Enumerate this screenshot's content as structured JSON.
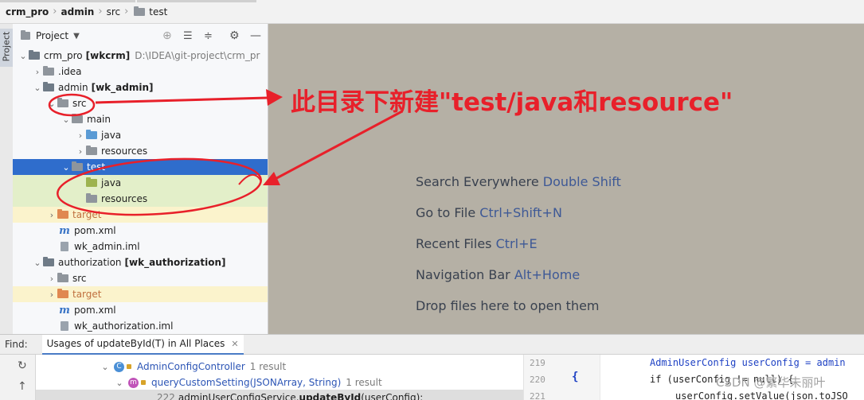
{
  "breadcrumb": {
    "items": [
      "crm_pro",
      "admin",
      "src",
      "test"
    ]
  },
  "side_tab": {
    "label": "Project"
  },
  "project_panel": {
    "title": "Project",
    "tree": [
      {
        "label": "crm_pro",
        "module": "[wkcrm]",
        "path": "D:\\IDEA\\git-project\\crm_pr",
        "kind": "module",
        "state": "open"
      },
      {
        "label": ".idea",
        "kind": "folder",
        "state": "closed"
      },
      {
        "label": "admin",
        "module": "[wk_admin]",
        "kind": "module",
        "state": "open"
      },
      {
        "label": "src",
        "kind": "folder",
        "state": "open"
      },
      {
        "label": "main",
        "kind": "folder",
        "state": "open"
      },
      {
        "label": "java",
        "kind": "source",
        "state": "closed"
      },
      {
        "label": "resources",
        "kind": "resources",
        "state": "closed"
      },
      {
        "label": "test",
        "kind": "folder",
        "state": "open",
        "selected": true
      },
      {
        "label": "java",
        "kind": "test-source"
      },
      {
        "label": "resources",
        "kind": "test-resources"
      },
      {
        "label": "target",
        "kind": "excluded",
        "state": "closed"
      },
      {
        "label": "pom.xml",
        "kind": "maven"
      },
      {
        "label": "wk_admin.iml",
        "kind": "iml"
      },
      {
        "label": "authorization",
        "module": "[wk_authorization]",
        "kind": "module",
        "state": "open"
      },
      {
        "label": "src",
        "kind": "folder",
        "state": "closed"
      },
      {
        "label": "target",
        "kind": "excluded",
        "state": "closed"
      },
      {
        "label": "pom.xml",
        "kind": "maven"
      },
      {
        "label": "wk_authorization.iml",
        "kind": "iml"
      }
    ]
  },
  "editor": {
    "hints": [
      {
        "text": "Search Everywhere",
        "key": "Double Shift"
      },
      {
        "text": "Go to File",
        "key": "Ctrl+Shift+N"
      },
      {
        "text": "Recent Files",
        "key": "Ctrl+E"
      },
      {
        "text": "Navigation Bar",
        "key": "Alt+Home"
      },
      {
        "text": "Drop files here to open them",
        "key": ""
      }
    ]
  },
  "annotation": {
    "text": "此目录下新建\"test/java和resource\"",
    "color": "#e8202a"
  },
  "find": {
    "label": "Find:",
    "tab": "Usages of updateById(T) in All Places"
  },
  "usages": {
    "class_row": {
      "name": "AdminConfigController",
      "count": "1 result"
    },
    "method_row": {
      "name": "queryCustomSetting(JSONArray, String)",
      "count": "1 result"
    },
    "line_row": {
      "num": "222",
      "text_pre": "adminUserConfigService.",
      "text_bold": "updateById",
      "text_post": "(userConfig);"
    }
  },
  "code": {
    "lines": [
      {
        "num": "219",
        "text": "AdminUserConfig userConfig = admin"
      },
      {
        "num": "220",
        "text": "if (userConfig != null) {"
      },
      {
        "num": "221",
        "text": "userConfig.setValue(json.toJSO"
      }
    ],
    "brace": "{"
  },
  "watermark": "CSDN @繁华未丽叶"
}
